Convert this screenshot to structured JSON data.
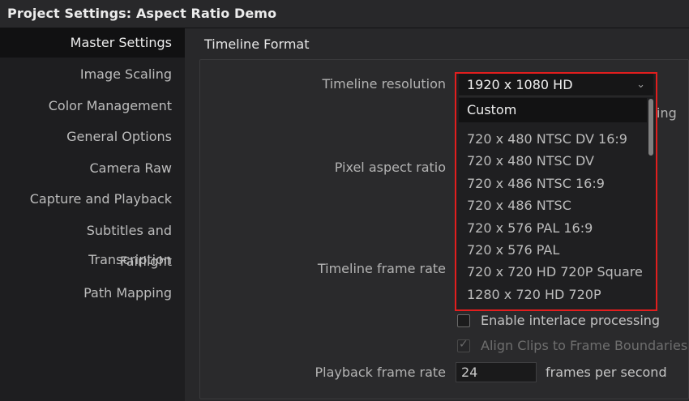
{
  "window": {
    "title": "Project Settings:  Aspect Ratio Demo"
  },
  "sidebar": {
    "items": [
      {
        "label": "Master Settings",
        "active": true
      },
      {
        "label": "Image Scaling"
      },
      {
        "label": "Color Management"
      },
      {
        "label": "General Options"
      },
      {
        "label": "Camera Raw"
      },
      {
        "label": "Capture and Playback"
      },
      {
        "label": "Subtitles and Transcription"
      },
      {
        "label": "Fairlight"
      },
      {
        "label": "Path Mapping"
      }
    ]
  },
  "main": {
    "section_title": "Timeline Format",
    "labels": {
      "timeline_resolution": "Timeline resolution",
      "pixel_aspect_ratio": "Pixel aspect ratio",
      "timeline_frame_rate": "Timeline frame rate",
      "playback_frame_rate": "Playback frame rate"
    },
    "resolution_dropdown": {
      "selected": "1920 x 1080 HD",
      "options": [
        "Custom",
        "720 x 480 NTSC DV 16:9",
        "720 x 480 NTSC DV",
        "720 x 486 NTSC 16:9",
        "720 x 486 NTSC",
        "720 x 576 PAL 16:9",
        "720 x 576 PAL",
        "720 x 720 HD 720P Square",
        "1280 x 720 HD 720P"
      ]
    },
    "partial_text_right": "ing",
    "checkboxes": {
      "interlace": {
        "label": "Enable interlace processing",
        "checked": false
      },
      "align_clips": {
        "label": "Align Clips to Frame Boundaries",
        "checked": true,
        "disabled": true
      }
    },
    "playback_frame_rate_value": "24",
    "frames_unit": "frames per second"
  },
  "colors": {
    "highlight_border": "#e21e1e",
    "active_nav_bg": "#111112"
  }
}
